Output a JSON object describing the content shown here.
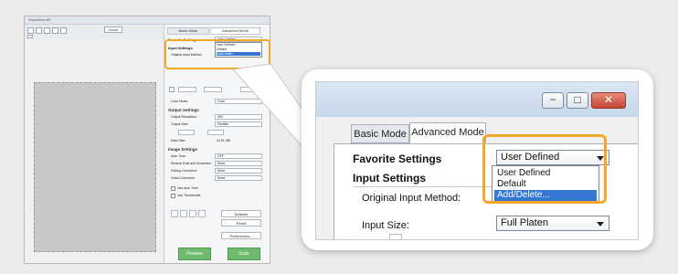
{
  "thumbnail": {
    "title": "ScanGear MF",
    "zoom_label": "Zoom",
    "tab_basic": "Basic Mode",
    "tab_advanced": "Advanced Mode",
    "favorite_settings": "Favorite Settings",
    "input_settings": "Input Settings",
    "original_input_method": "Original Input Method:",
    "favorite_value": "User Defined",
    "dropdown_options": [
      "User Defined",
      "Default",
      "Add/Delete..."
    ],
    "color_mode": "Color Mode:",
    "color_mode_value": "Color",
    "output_settings": "Output Settings",
    "output_resolution": "Output Resolution:",
    "output_resolution_value": "300",
    "output_size": "Output Size:",
    "output_size_value": "Flexible",
    "data_size": "Data Size:",
    "data_size_value": "24.91 MB",
    "image_settings": "Image Settings",
    "auto_tone": "Auto Tone:",
    "auto_tone_value": "OFF",
    "reduce_dust": "Reduce Dust and Scratches:",
    "fading_correction": "Fading Correction:",
    "grain_correction": "Grain Correction:",
    "none_value": "None",
    "use_auto_tone": "Use Auto Tone",
    "preview_thumb": "Use Thumbnails",
    "defaults_btn": "Defaults",
    "reset_btn": "Reset",
    "preferences_btn": "Preferences...",
    "preview_btn": "Preview",
    "scan_btn": "Scan"
  },
  "callout": {
    "tab_basic": "Basic Mode",
    "tab_advanced": "Advanced Mode",
    "favorite_settings": "Favorite Settings",
    "favorite_value": "User Defined",
    "dropdown_options": [
      "User Defined",
      "Default",
      "Add/Delete..."
    ],
    "input_settings": "Input Settings",
    "original_input_method": "Original Input Method:",
    "input_size": "Input Size:",
    "input_size_value": "Full Platen",
    "minimize_icon": "minimize-icon",
    "maximize_icon": "maximize-icon",
    "close_icon": "close-icon"
  },
  "colors": {
    "highlight": "#f3a728",
    "selection": "#3478d4",
    "scan_button": "#6fba6f"
  }
}
